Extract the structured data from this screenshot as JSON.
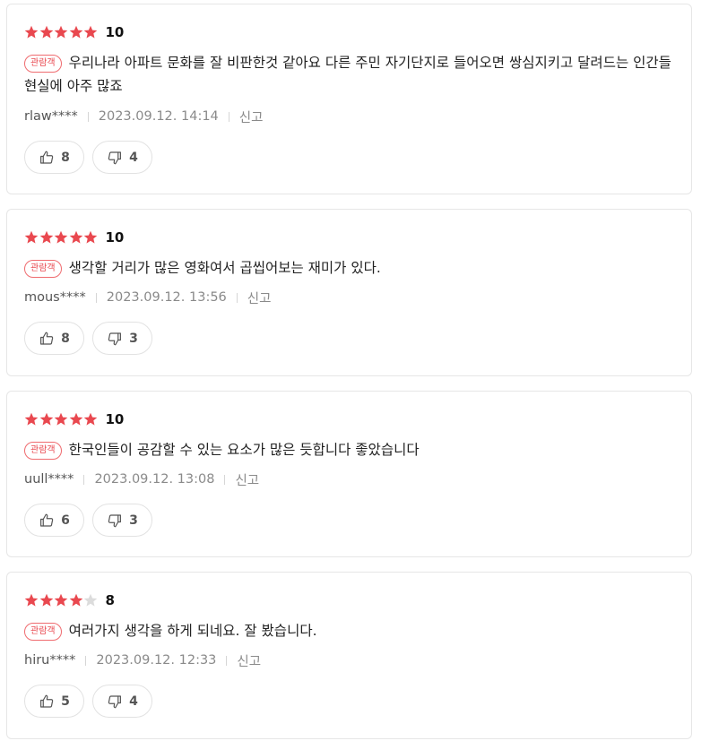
{
  "reviews": [
    {
      "stars_filled": 5,
      "stars_total": 5,
      "score": "10",
      "badge": "관람객",
      "text": "우리나라 아파트 문화를 잘 비판한것 같아요 다른 주민 자기단지로 들어오면 쌍심지키고 달려드는 인간들 현실에 아주 많죠",
      "author": "rlaw****",
      "datetime": "2023.09.12. 14:14",
      "report_label": "신고",
      "likes": "8",
      "dislikes": "4"
    },
    {
      "stars_filled": 5,
      "stars_total": 5,
      "score": "10",
      "badge": "관람객",
      "text": "생각할 거리가 많은 영화여서 곱씹어보는 재미가 있다.",
      "author": "mous****",
      "datetime": "2023.09.12. 13:56",
      "report_label": "신고",
      "likes": "8",
      "dislikes": "3"
    },
    {
      "stars_filled": 5,
      "stars_total": 5,
      "score": "10",
      "badge": "관람객",
      "text": "한국인들이 공감할 수 있는 요소가 많은 듯합니다 좋았습니다",
      "author": "uull****",
      "datetime": "2023.09.12. 13:08",
      "report_label": "신고",
      "likes": "6",
      "dislikes": "3"
    },
    {
      "stars_filled": 4,
      "stars_total": 5,
      "score": "8",
      "badge": "관람객",
      "text": "여러가지 생각을 하게 되네요. 잘 봤습니다.",
      "author": "hiru****",
      "datetime": "2023.09.12. 12:33",
      "report_label": "신고",
      "likes": "5",
      "dislikes": "4"
    }
  ],
  "colors": {
    "star_filled": "#e9484f",
    "star_empty": "#dcdcdc",
    "badge": "#e9484f"
  },
  "icons": {
    "like": "thumbs-up-icon",
    "dislike": "thumbs-down-icon",
    "star": "star-icon"
  }
}
